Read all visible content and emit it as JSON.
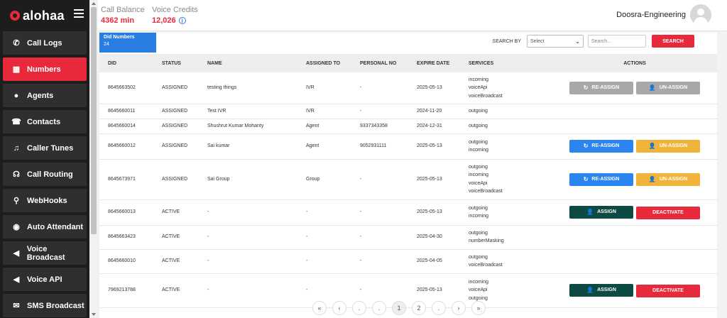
{
  "brand": {
    "name": "alohaa"
  },
  "sidebar": {
    "items": [
      {
        "label": "Call Logs",
        "icon": "phone-icon",
        "glyph": "✆"
      },
      {
        "label": "Numbers",
        "icon": "grid-icon",
        "glyph": "▦",
        "active": true
      },
      {
        "label": "Agents",
        "icon": "user-icon",
        "glyph": "●"
      },
      {
        "label": "Contacts",
        "icon": "contacts-icon",
        "glyph": "☎"
      },
      {
        "label": "Caller Tunes",
        "icon": "music-icon",
        "glyph": "♫"
      },
      {
        "label": "Call Routing",
        "icon": "headset-icon",
        "glyph": "☊"
      },
      {
        "label": "WebHooks",
        "icon": "webhook-icon",
        "glyph": "⚲"
      },
      {
        "label": "Auto Attendant",
        "icon": "attendant-icon",
        "glyph": "◉"
      },
      {
        "label": "Voice Broadcast",
        "icon": "megaphone-icon",
        "glyph": "◀"
      },
      {
        "label": "Voice API",
        "icon": "voice-api-icon",
        "glyph": "◀"
      },
      {
        "label": "SMS Broadcast",
        "icon": "sms-icon",
        "glyph": "✉"
      }
    ]
  },
  "header": {
    "call_balance_label": "Call Balance",
    "call_balance_value": "4362 min",
    "voice_credits_label": "Voice Credits",
    "voice_credits_value": "12,026",
    "user_name": "Doosra-Engineering"
  },
  "did_tab": {
    "title": "Did Numbers",
    "count": "24"
  },
  "search": {
    "label": "SEARCH BY",
    "select_value": "Select",
    "placeholder": "Search...",
    "button": "SEARCH"
  },
  "table": {
    "headers": [
      "DID",
      "STATUS",
      "NAME",
      "ASSIGNED TO",
      "PERSONAL NO",
      "EXPIRE DATE",
      "SERVICES",
      "ACTIONS"
    ],
    "rows": [
      {
        "did": "8645663502",
        "status": "ASSIGNED",
        "name": "testing things",
        "assigned": "IVR",
        "personal": "-",
        "expire": "2025-05-13",
        "services": [
          "incoming",
          "voiceApi",
          "voiceBroadcast"
        ],
        "actions": "reassign-grey"
      },
      {
        "did": "8645660011",
        "status": "ASSIGNED",
        "name": "Test IVR",
        "assigned": "IVR",
        "personal": "-",
        "expire": "2024-11-20",
        "services": [
          "outgoing"
        ],
        "actions": "none"
      },
      {
        "did": "8645660014",
        "status": "ASSIGNED",
        "name": "Shushrut Kumar Mohanty",
        "assigned": "Agent",
        "personal": "9337343358",
        "expire": "2024-12-31",
        "services": [
          "outgoing"
        ],
        "actions": "none"
      },
      {
        "did": "8645660012",
        "status": "ASSIGNED",
        "name": "Sai kumar",
        "assigned": "Agent",
        "personal": "9052931111",
        "expire": "2025-05-13",
        "services": [
          "outgoing",
          "incoming"
        ],
        "actions": "reassign"
      },
      {
        "did": "8645673971",
        "status": "ASSIGNED",
        "name": "Sai Group",
        "assigned": "Group",
        "personal": "-",
        "expire": "2025-05-13",
        "services": [
          "outgoing",
          "incoming",
          "voiceApi",
          "voiceBroadcast"
        ],
        "actions": "reassign"
      },
      {
        "did": "8645660013",
        "status": "ACTIVE",
        "name": "-",
        "assigned": "-",
        "personal": "-",
        "expire": "2025-05-13",
        "services": [
          "outgoing",
          "incoming"
        ],
        "actions": "assign"
      },
      {
        "did": "8645663423",
        "status": "ACTIVE",
        "name": "-",
        "assigned": "-",
        "personal": "-",
        "expire": "2025-04-30",
        "services": [
          "outgoing",
          "numberMasking"
        ],
        "actions": "none"
      },
      {
        "did": "8645660010",
        "status": "ACTIVE",
        "name": "-",
        "assigned": "-",
        "personal": "-",
        "expire": "2025-04-05",
        "services": [
          "outgoing",
          "voiceBroadcast"
        ],
        "actions": "none"
      },
      {
        "did": "7969213788",
        "status": "ACTIVE",
        "name": "-",
        "assigned": "-",
        "personal": "-",
        "expire": "2025-05-13",
        "services": [
          "incoming",
          "voiceApi",
          "outgoing"
        ],
        "actions": "assign"
      }
    ],
    "buttons": {
      "reassign": "RE-ASSIGN",
      "unassign": "UN-ASSIGN",
      "assign": "ASSIGN",
      "deactivate": "DEACTIVATE"
    }
  },
  "pagination": [
    "«",
    "‹",
    ".",
    ".",
    "1",
    "2",
    ".",
    "›",
    "»"
  ],
  "colors": {
    "accent": "#e8293b",
    "blue": "#2a7de1",
    "sidebar": "#1d1d1d"
  }
}
